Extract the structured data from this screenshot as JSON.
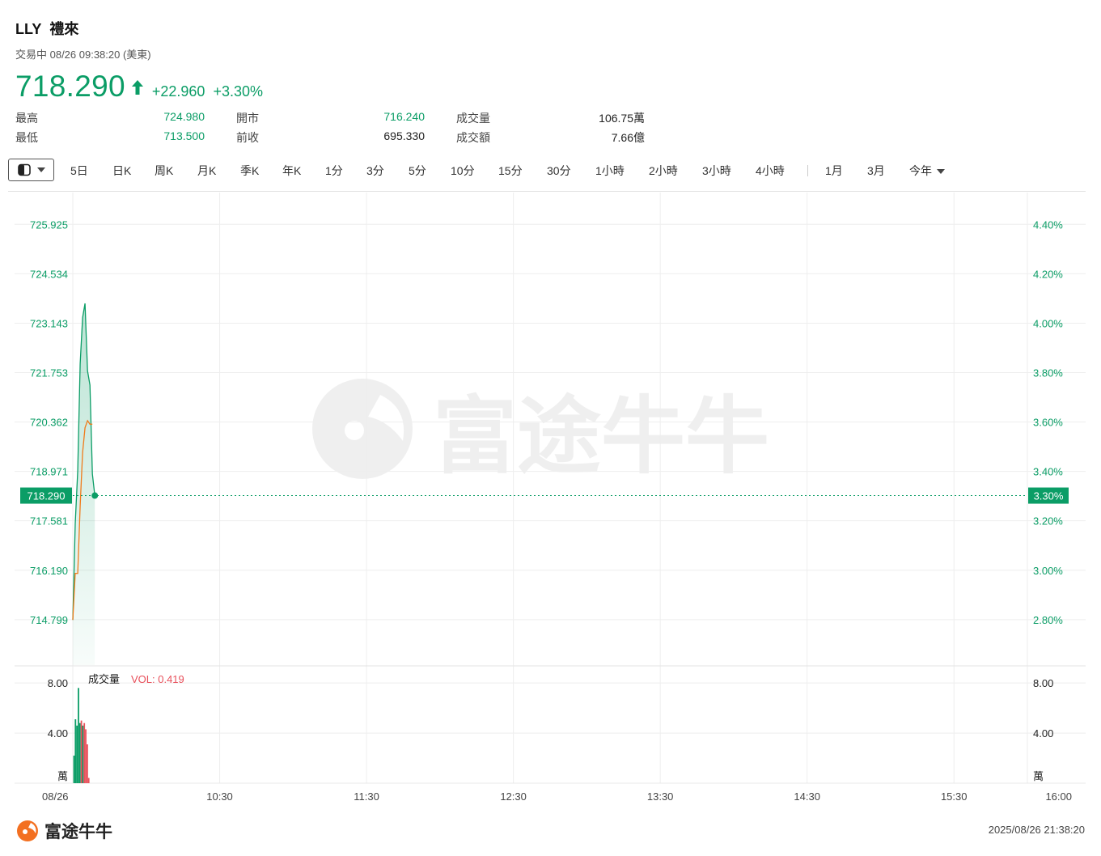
{
  "header": {
    "symbol": "LLY",
    "name": "禮來",
    "status": "交易中 08/26 09:38:20 (美東)",
    "price": "718.290",
    "change": "+22.960",
    "change_pct": "+3.30%"
  },
  "stats": [
    {
      "label": "最高",
      "value": "724.980"
    },
    {
      "label": "最低",
      "value": "713.500"
    },
    {
      "label": "開市",
      "value": "716.240"
    },
    {
      "label": "前收",
      "value": "695.330"
    },
    {
      "label": "成交量",
      "value": "106.75萬"
    },
    {
      "label": "成交額",
      "value": "7.66億"
    }
  ],
  "toolbar": {
    "periods": [
      "5日",
      "日K",
      "周K",
      "月K",
      "季K",
      "年K",
      "1分",
      "3分",
      "5分",
      "10分",
      "15分",
      "30分",
      "1小時",
      "2小時",
      "3小時",
      "4小時",
      "1月",
      "3月",
      "今年"
    ]
  },
  "colors": {
    "up": "#0b9d66",
    "down": "#e8505b",
    "avg_line": "#f07b1b",
    "grid": "#eeeeee"
  },
  "chart_data": {
    "type": "line",
    "price_axis": {
      "ticks": [
        "725.925",
        "724.534",
        "723.143",
        "721.753",
        "720.362",
        "718.971",
        "717.581",
        "716.190",
        "714.799"
      ],
      "tick_values": [
        725.925,
        724.534,
        723.143,
        721.753,
        720.362,
        718.971,
        717.581,
        716.19,
        714.799
      ],
      "ylim": [
        713.52,
        726.82
      ]
    },
    "pct_axis": {
      "ticks": [
        "4.40%",
        "4.20%",
        "4.00%",
        "3.80%",
        "3.60%",
        "3.40%",
        "3.20%",
        "3.00%",
        "2.80%"
      ]
    },
    "x_axis": {
      "ticks": [
        "08/26",
        "10:30",
        "11:30",
        "12:30",
        "13:30",
        "14:30",
        "15:30",
        "16:00"
      ],
      "tick_minutes": [
        0,
        60,
        120,
        180,
        240,
        300,
        360,
        390
      ],
      "xlim_minutes": [
        0,
        390
      ]
    },
    "current_price_label": "718.290",
    "current_pct_label": "3.30%",
    "current_value": 718.29,
    "series": [
      {
        "type": "price",
        "points": [
          [
            0,
            714.79
          ],
          [
            1,
            717.5
          ],
          [
            2,
            719.0
          ],
          [
            3,
            722.0
          ],
          [
            4,
            723.3
          ],
          [
            5,
            723.7
          ],
          [
            6,
            721.8
          ],
          [
            7,
            721.4
          ],
          [
            8,
            718.9
          ],
          [
            9,
            718.29
          ]
        ]
      },
      {
        "type": "average",
        "points": [
          [
            0,
            714.79
          ],
          [
            1,
            716.1
          ],
          [
            2,
            716.1
          ],
          [
            3,
            718.0
          ],
          [
            4,
            719.5
          ],
          [
            5,
            720.2
          ],
          [
            6,
            720.4
          ],
          [
            7,
            720.3
          ],
          [
            8,
            720.3
          ]
        ]
      }
    ],
    "volume": {
      "label": "成交量",
      "vol_label": "VOL: 0.419",
      "ticks": [
        "8.00",
        "4.00"
      ],
      "tick_values": [
        8,
        4
      ],
      "unit": "萬",
      "ylim": [
        0,
        9.3
      ],
      "bars": [
        {
          "t": 0.5,
          "v": 2.2,
          "dir": "up"
        },
        {
          "t": 1.1,
          "v": 5.1,
          "dir": "up"
        },
        {
          "t": 1.7,
          "v": 4.6,
          "dir": "up"
        },
        {
          "t": 2.3,
          "v": 7.6,
          "dir": "up"
        },
        {
          "t": 2.9,
          "v": 4.8,
          "dir": "up"
        },
        {
          "t": 3.5,
          "v": 5.0,
          "dir": "down"
        },
        {
          "t": 4.1,
          "v": 4.6,
          "dir": "up"
        },
        {
          "t": 4.7,
          "v": 4.8,
          "dir": "down"
        },
        {
          "t": 5.3,
          "v": 4.3,
          "dir": "down"
        },
        {
          "t": 5.9,
          "v": 3.1,
          "dir": "down"
        },
        {
          "t": 6.5,
          "v": 0.42,
          "dir": "down"
        }
      ]
    }
  },
  "footer": {
    "brand": "富途牛牛",
    "timestamp": "2025/08/26 21:38:20"
  }
}
